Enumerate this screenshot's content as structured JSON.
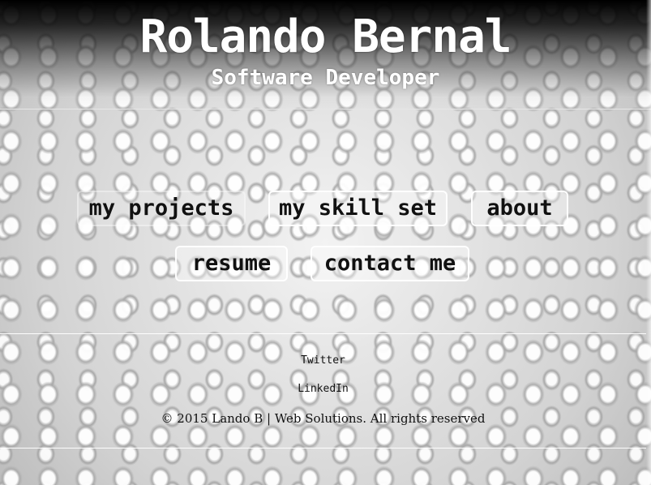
{
  "header": {
    "title": "Rolando Bernal",
    "subtitle": "Software Developer"
  },
  "nav": {
    "projects": "my projects",
    "skills": "my skill set",
    "about": "about",
    "resume": "resume",
    "contact": "contact me"
  },
  "footer": {
    "twitter": "Twitter",
    "linkedin": "LinkedIn",
    "copyright": "© 2015 Lando B | Web Solutions. All rights reserved"
  },
  "colors": {
    "header_top": "#000000",
    "title_text": "#ffffff",
    "body_text": "#111111",
    "button_border": "#ffffff"
  }
}
